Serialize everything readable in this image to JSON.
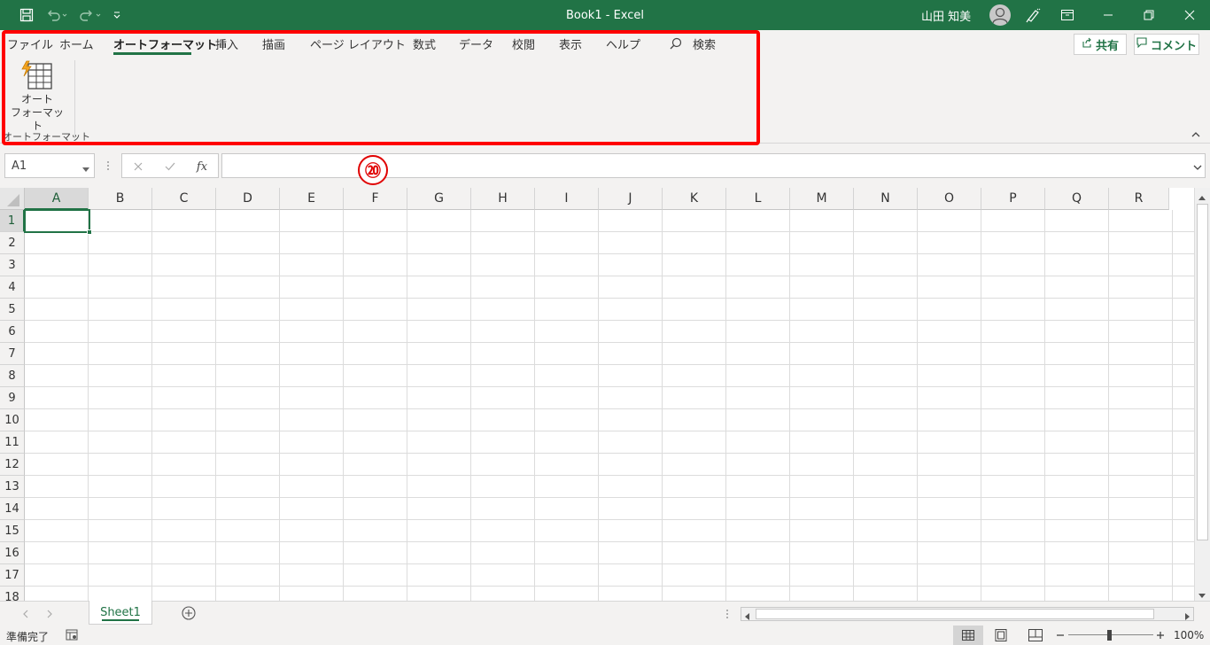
{
  "titlebar": {
    "title": "Book1  -  Excel",
    "user": "山田 知美",
    "accent": "#217346"
  },
  "ribbon": {
    "tabs": [
      {
        "label": "ファイル",
        "active": false
      },
      {
        "label": "ホーム",
        "active": false
      },
      {
        "label": "オートフォーマット",
        "active": true
      },
      {
        "label": "挿入",
        "active": false
      },
      {
        "label": "描画",
        "active": false
      },
      {
        "label": "ページ レイアウト",
        "active": false
      },
      {
        "label": "数式",
        "active": false
      },
      {
        "label": "データ",
        "active": false
      },
      {
        "label": "校閲",
        "active": false
      },
      {
        "label": "表示",
        "active": false
      },
      {
        "label": "ヘルプ",
        "active": false
      }
    ],
    "search_label": "検索",
    "share_label": "共有",
    "comment_label": "コメント",
    "autoformat_button_line1": "オート",
    "autoformat_button_line2": "フォーマット",
    "group_label": "オートフォーマット",
    "highlight_color": "#ff0000"
  },
  "formula": {
    "namebox": "A1",
    "fx": "fx",
    "value": ""
  },
  "annotation_badge": "⑳",
  "grid": {
    "columns": [
      "A",
      "B",
      "C",
      "D",
      "E",
      "F",
      "G",
      "H",
      "I",
      "J",
      "K",
      "L",
      "M",
      "N",
      "O",
      "P",
      "Q",
      "R"
    ],
    "rows": [
      "1",
      "2",
      "3",
      "4",
      "5",
      "6",
      "7",
      "8",
      "9",
      "10",
      "11",
      "12",
      "13",
      "14",
      "15",
      "16",
      "17",
      "18"
    ],
    "selected_cell": "A1"
  },
  "sheets": {
    "tabs": [
      "Sheet1"
    ],
    "active": "Sheet1"
  },
  "status": {
    "ready": "準備完了",
    "zoom": "100%"
  }
}
